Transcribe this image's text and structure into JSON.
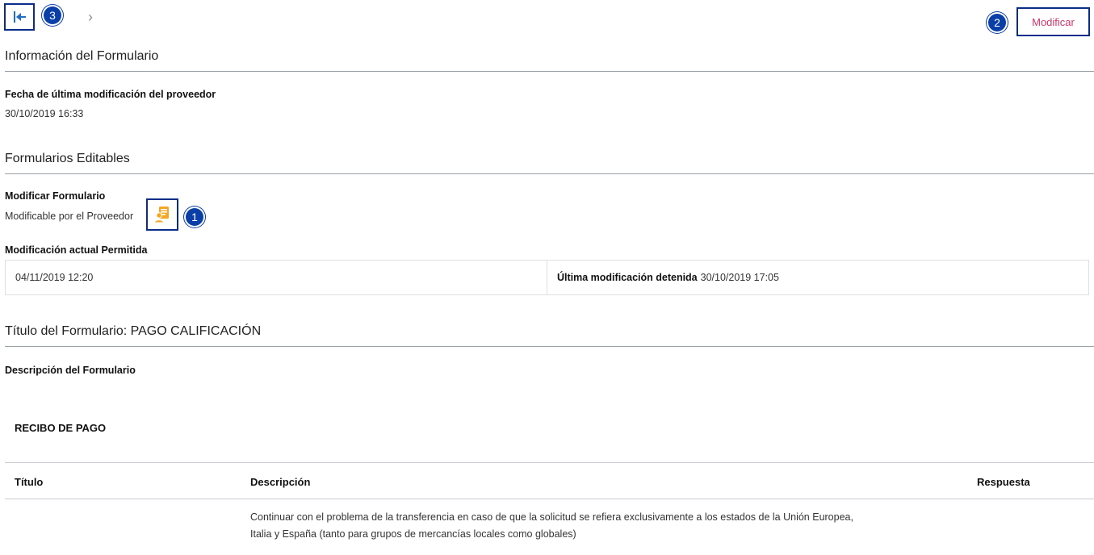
{
  "toolbar": {
    "first_icon": "first-page-icon",
    "next_icon": "chevron-right-icon",
    "next_glyph": "›",
    "modify_label": "Modificar",
    "badges": {
      "first": "3",
      "modify": "2",
      "icon": "1"
    }
  },
  "form_info": {
    "title": "Información del Formulario",
    "last_mod_label": "Fecha de última modificación del proveedor",
    "last_mod_value": "30/10/2019 16:33"
  },
  "editable": {
    "title": "Formularios Editables",
    "modify_form_label": "Modificar Formulario",
    "modify_form_value": "Modificable por el Proveedor",
    "supplier_icon": "supplier-document-icon",
    "current_mod_label": "Modificación actual Permitida",
    "current_mod_value": "04/11/2019 12:20",
    "last_stopped_label": "Última modificación detenida",
    "last_stopped_value": "30/10/2019 17:05"
  },
  "form": {
    "title": "Título del Formulario: PAGO CALIFICACIÓN",
    "description_label": "Descripción del Formulario",
    "receipt_heading": "RECIBO DE PAGO",
    "columns": {
      "title": "Título",
      "description": "Descripción",
      "response": "Respuesta"
    },
    "row_lines": [
      "Continuar con el problema de la transferencia en caso de que la solicitud se refiera exclusivamente a los estados de la Unión Europea,",
      "Italia y España (tanto para grupos de mercancías locales como globales)"
    ]
  },
  "colors": {
    "accent": "#d1366a",
    "badge": "#0b3fa8",
    "highlight_border": "#0a2d8a",
    "icon": "#f5a623"
  }
}
